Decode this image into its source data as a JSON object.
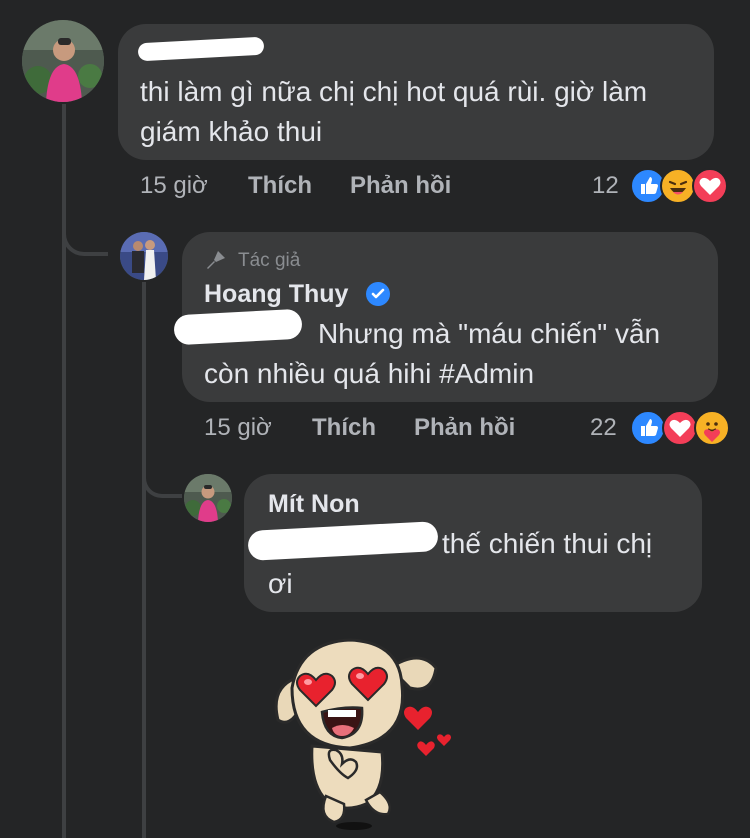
{
  "comment1": {
    "text_line1": "thi làm gì nữa chị chị hot quá rùi. giờ làm",
    "text_line2": "giám khảo thui",
    "time": "15 giờ",
    "like_label": "Thích",
    "reply_label": "Phản hồi",
    "reaction_count": "12",
    "reactions": [
      "like-icon",
      "haha-icon",
      "love-icon"
    ]
  },
  "comment2": {
    "author_badge": "Tác giả",
    "name": "Hoang Thuy",
    "verified": true,
    "text_line1": "Nhưng mà \"máu chiến\" vẫn",
    "text_line2": "còn nhiều quá hihi #Admin",
    "time": "15 giờ",
    "like_label": "Thích",
    "reply_label": "Phản hồi",
    "reaction_count": "22",
    "reactions": [
      "like-icon",
      "love-icon",
      "care-icon"
    ]
  },
  "comment3": {
    "name": "Mít Non",
    "text_line1": "thế chiến thui chị",
    "text_line2": "ơi",
    "sticker": "dog-hearts-sticker"
  },
  "colors": {
    "background": "#242526",
    "bubble": "#3a3b3c",
    "like": "#2d88ff",
    "love": "#f33e58",
    "haha": "#f7b125"
  }
}
